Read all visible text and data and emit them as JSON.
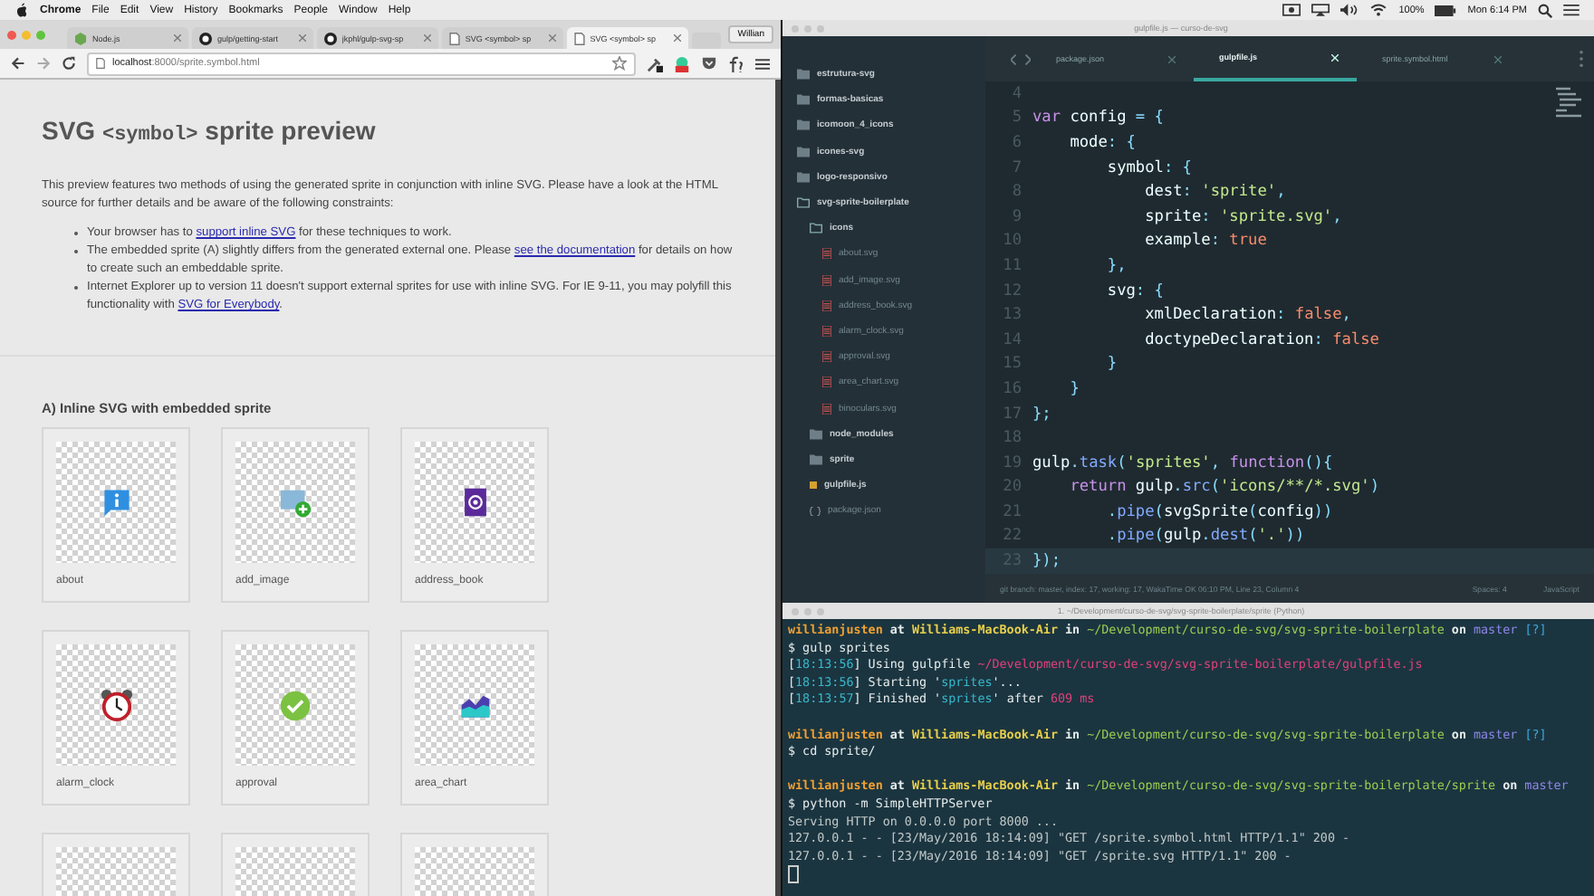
{
  "menu_bar": {
    "app": "Chrome",
    "items": [
      "File",
      "Edit",
      "View",
      "History",
      "Bookmarks",
      "People",
      "Window",
      "Help"
    ],
    "battery": "100%",
    "clock": "Mon 6:14 PM"
  },
  "browser": {
    "tabs": [
      {
        "title": "Node.js",
        "kind": "node",
        "selected": false
      },
      {
        "title": "gulp/getting-start",
        "kind": "repo",
        "selected": false
      },
      {
        "title": "jkphl/gulp-svg-sp",
        "kind": "repo",
        "selected": false
      },
      {
        "title": "SVG <symbol> sp",
        "kind": "page",
        "selected": false
      },
      {
        "title": "SVG <symbol> sp",
        "kind": "page",
        "selected": true
      }
    ],
    "profile": "Willian",
    "url_host": "localhost",
    "url_path": ":8000/sprite.symbol.html",
    "page": {
      "title_before": "SVG ",
      "title_code": "<symbol>",
      "title_after": " sprite preview",
      "intro": "This preview features two methods of using the generated sprite in conjunction with inline SVG. Please have a look at the HTML source for further details and be aware of the following constraints:",
      "bullets": [
        [
          {
            "text": "Your browser has to "
          },
          {
            "text": "support inline SVG",
            "link": true
          },
          {
            "text": " for these techniques to work."
          }
        ],
        [
          {
            "text": "The embedded sprite (A) slightly differs from the generated external one. Please "
          },
          {
            "text": "see the documentation",
            "link": true
          },
          {
            "text": " for details on how to create such an embeddable sprite."
          }
        ],
        [
          {
            "text": "Internet Explorer up to version 11 doesn't support external sprites for use with inline SVG. For IE 9-11, you may polyfill this functionality with "
          },
          {
            "text": "SVG for Everybody",
            "link": true
          },
          {
            "text": "."
          }
        ]
      ],
      "section_title": "A) Inline SVG with embedded sprite",
      "sprites": [
        {
          "kind": "info",
          "label": "about"
        },
        {
          "kind": "image-add",
          "label": "add_image"
        },
        {
          "kind": "address-book",
          "label": "address_book"
        },
        {
          "kind": "alarm",
          "label": "alarm_clock"
        },
        {
          "kind": "check",
          "label": "approval"
        },
        {
          "kind": "area-chart",
          "label": "area_chart"
        },
        {
          "kind": "blank"
        },
        {
          "kind": "blank"
        },
        {
          "kind": "blank"
        }
      ]
    }
  },
  "editor": {
    "title": "gulpfile.js — curso-de-svg",
    "sidebar": [
      {
        "name": "estrutura-svg",
        "kind": "folder",
        "expanded": false
      },
      {
        "name": "formas-basicas",
        "kind": "folder",
        "expanded": false
      },
      {
        "name": "icomoon_4_icons",
        "kind": "folder",
        "expanded": false
      },
      {
        "name": "icones-svg",
        "kind": "folder",
        "expanded": false
      },
      {
        "name": "logo-responsivo",
        "kind": "folder",
        "expanded": false
      },
      {
        "name": "svg-sprite-boilerplate",
        "kind": "folder",
        "expanded": true,
        "children": [
          {
            "name": "icons",
            "kind": "folder",
            "expanded": true,
            "children": [
              {
                "name": "about.svg",
                "kind": "svg"
              },
              {
                "name": "add_image.svg",
                "kind": "svg"
              },
              {
                "name": "address_book.svg",
                "kind": "svg"
              },
              {
                "name": "alarm_clock.svg",
                "kind": "svg"
              },
              {
                "name": "approval.svg",
                "kind": "svg"
              },
              {
                "name": "area_chart.svg",
                "kind": "svg"
              },
              {
                "name": "binoculars.svg",
                "kind": "svg"
              }
            ]
          },
          {
            "name": "node_modules",
            "kind": "folder",
            "expanded": false
          },
          {
            "name": "sprite",
            "kind": "folder",
            "expanded": false
          },
          {
            "name": "gulpfile.js",
            "kind": "js"
          },
          {
            "name": "package.json",
            "kind": "json"
          }
        ]
      }
    ],
    "tabs": [
      {
        "title": "package.json",
        "selected": false
      },
      {
        "title": "gulpfile.js",
        "selected": true
      },
      {
        "title": "sprite.symbol.html",
        "selected": false
      }
    ],
    "lines": [
      {
        "number": "4",
        "current": false
      },
      {
        "number": "5",
        "current": false,
        "tokens": [
          {
            "kind": "kw",
            "text": "var "
          },
          {
            "kind": "id",
            "text": "config "
          },
          {
            "kind": "op",
            "text": "= {"
          }
        ]
      },
      {
        "number": "6",
        "current": false,
        "tokens": [
          {
            "kind": "id",
            "text": "    mode"
          },
          {
            "kind": "op",
            "text": ": {"
          }
        ]
      },
      {
        "number": "7",
        "current": false,
        "tokens": [
          {
            "kind": "id",
            "text": "        symbol"
          },
          {
            "kind": "op",
            "text": ": {"
          }
        ]
      },
      {
        "number": "8",
        "current": false,
        "tokens": [
          {
            "kind": "id",
            "text": "            dest"
          },
          {
            "kind": "op",
            "text": ": "
          },
          {
            "kind": "str",
            "text": "'sprite'"
          },
          {
            "kind": "op",
            "text": ","
          }
        ]
      },
      {
        "number": "9",
        "current": false,
        "tokens": [
          {
            "kind": "id",
            "text": "            sprite"
          },
          {
            "kind": "op",
            "text": ": "
          },
          {
            "kind": "str",
            "text": "'sprite.svg'"
          },
          {
            "kind": "op",
            "text": ","
          }
        ]
      },
      {
        "number": "10",
        "current": false,
        "tokens": [
          {
            "kind": "id",
            "text": "            example"
          },
          {
            "kind": "op",
            "text": ": "
          },
          {
            "kind": "bool",
            "text": "true"
          }
        ]
      },
      {
        "number": "11",
        "current": false,
        "tokens": [
          {
            "kind": "op",
            "text": "        },"
          }
        ]
      },
      {
        "number": "12",
        "current": false,
        "tokens": [
          {
            "kind": "id",
            "text": "        svg"
          },
          {
            "kind": "op",
            "text": ": {"
          }
        ]
      },
      {
        "number": "13",
        "current": false,
        "tokens": [
          {
            "kind": "id",
            "text": "            xmlDeclaration"
          },
          {
            "kind": "op",
            "text": ": "
          },
          {
            "kind": "bool",
            "text": "false"
          },
          {
            "kind": "op",
            "text": ","
          }
        ]
      },
      {
        "number": "14",
        "current": false,
        "tokens": [
          {
            "kind": "id",
            "text": "            doctypeDeclaration"
          },
          {
            "kind": "op",
            "text": ": "
          },
          {
            "kind": "bool",
            "text": "false"
          }
        ]
      },
      {
        "number": "15",
        "current": false,
        "tokens": [
          {
            "kind": "op",
            "text": "        }"
          }
        ]
      },
      {
        "number": "16",
        "current": false,
        "tokens": [
          {
            "kind": "op",
            "text": "    }"
          }
        ]
      },
      {
        "number": "17",
        "current": false,
        "tokens": [
          {
            "kind": "op",
            "text": "};"
          }
        ]
      },
      {
        "number": "18",
        "current": false
      },
      {
        "number": "19",
        "current": false,
        "tokens": [
          {
            "kind": "id",
            "text": "gulp"
          },
          {
            "kind": "op",
            "text": "."
          },
          {
            "kind": "fn",
            "text": "task"
          },
          {
            "kind": "op",
            "text": "("
          },
          {
            "kind": "str",
            "text": "'sprites'"
          },
          {
            "kind": "op",
            "text": ", "
          },
          {
            "kind": "kw",
            "text": "function"
          },
          {
            "kind": "op",
            "text": "(){"
          }
        ]
      },
      {
        "number": "20",
        "current": false,
        "tokens": [
          {
            "kind": "kw",
            "text": "    return "
          },
          {
            "kind": "id",
            "text": "gulp"
          },
          {
            "kind": "op",
            "text": "."
          },
          {
            "kind": "fn",
            "text": "src"
          },
          {
            "kind": "op",
            "text": "("
          },
          {
            "kind": "str",
            "text": "'icons/**/*.svg'"
          },
          {
            "kind": "op",
            "text": ")"
          }
        ]
      },
      {
        "number": "21",
        "current": false,
        "tokens": [
          {
            "kind": "op",
            "text": "        ."
          },
          {
            "kind": "fn",
            "text": "pipe"
          },
          {
            "kind": "op",
            "text": "("
          },
          {
            "kind": "id",
            "text": "svgSprite"
          },
          {
            "kind": "op",
            "text": "("
          },
          {
            "kind": "id",
            "text": "config"
          },
          {
            "kind": "op",
            "text": "))"
          }
        ]
      },
      {
        "number": "22",
        "current": false,
        "tokens": [
          {
            "kind": "op",
            "text": "        ."
          },
          {
            "kind": "fn",
            "text": "pipe"
          },
          {
            "kind": "op",
            "text": "("
          },
          {
            "kind": "id",
            "text": "gulp"
          },
          {
            "kind": "op",
            "text": "."
          },
          {
            "kind": "fn",
            "text": "dest"
          },
          {
            "kind": "op",
            "text": "("
          },
          {
            "kind": "str",
            "text": "'.'"
          },
          {
            "kind": "op",
            "text": "))"
          }
        ]
      },
      {
        "number": "23",
        "current": true,
        "tokens": [
          {
            "kind": "op",
            "text": "});"
          }
        ]
      }
    ],
    "status_left": "git branch: master, index: 17, working: 17, WakaTime OK 06:10 PM, Line 23, Column 4",
    "spaces": "Spaces: 4",
    "language": "JavaScript"
  },
  "terminal": {
    "title": "1. ~/Development/curso-de-svg/svg-sprite-boilerplate/sprite (Python)",
    "blocks": [
      [
        [
          {
            "kind": "user",
            "text": "willianjusten"
          },
          {
            "kind": "plain",
            "text": " at "
          },
          {
            "kind": "host",
            "text": "Williams-MacBook-Air"
          },
          {
            "kind": "plain",
            "text": " in "
          },
          {
            "kind": "path",
            "text": "~/Development/curso-de-svg/svg-sprite-boilerplate"
          },
          {
            "kind": "plain",
            "text": " on "
          },
          {
            "kind": "branch",
            "text": "master"
          },
          {
            "kind": "qmark",
            "text": " [?]"
          }
        ],
        [
          {
            "kind": "plain",
            "text": "$ gulp sprites"
          }
        ],
        [
          {
            "kind": "plain",
            "text": "["
          },
          {
            "kind": "time",
            "text": "18:13:56"
          },
          {
            "kind": "plain",
            "text": "] Using gulpfile "
          },
          {
            "kind": "file",
            "text": "~/Development/curso-de-svg/svg-sprite-boilerplate/gulpfile.js"
          }
        ],
        [
          {
            "kind": "plain",
            "text": "["
          },
          {
            "kind": "time",
            "text": "18:13:56"
          },
          {
            "kind": "plain",
            "text": "] Starting '"
          },
          {
            "kind": "time",
            "text": "sprites"
          },
          {
            "kind": "plain",
            "text": "'..."
          }
        ],
        [
          {
            "kind": "plain",
            "text": "["
          },
          {
            "kind": "time",
            "text": "18:13:57"
          },
          {
            "kind": "plain",
            "text": "] Finished '"
          },
          {
            "kind": "time",
            "text": "sprites"
          },
          {
            "kind": "plain",
            "text": "' after "
          },
          {
            "kind": "file",
            "text": "609 ms"
          }
        ]
      ],
      [
        [
          {
            "kind": "user",
            "text": "willianjusten"
          },
          {
            "kind": "plain",
            "text": " at "
          },
          {
            "kind": "host",
            "text": "Williams-MacBook-Air"
          },
          {
            "kind": "plain",
            "text": " in "
          },
          {
            "kind": "path",
            "text": "~/Development/curso-de-svg/svg-sprite-boilerplate"
          },
          {
            "kind": "plain",
            "text": " on "
          },
          {
            "kind": "branch",
            "text": "master"
          },
          {
            "kind": "qmark",
            "text": " [?]"
          }
        ],
        [
          {
            "kind": "plain",
            "text": "$ cd sprite/"
          }
        ]
      ],
      [
        [
          {
            "kind": "user",
            "text": "willianjusten"
          },
          {
            "kind": "plain",
            "text": " at "
          },
          {
            "kind": "host",
            "text": "Williams-MacBook-Air"
          },
          {
            "kind": "plain",
            "text": " in "
          },
          {
            "kind": "path",
            "text": "~/Development/curso-de-svg/svg-sprite-boilerplate/sprite"
          },
          {
            "kind": "plain",
            "text": " on "
          },
          {
            "kind": "branch",
            "text": "master"
          }
        ],
        [
          {
            "kind": "plain",
            "text": "$ python -m SimpleHTTPServer"
          }
        ],
        [
          {
            "kind": "dim",
            "text": "Serving HTTP on 0.0.0.0 port 8000 ..."
          }
        ],
        [
          {
            "kind": "dim",
            "text": "127.0.0.1 - - [23/May/2016 18:14:09] \"GET /sprite.symbol.html HTTP/1.1\" 200 -"
          }
        ],
        [
          {
            "kind": "dim",
            "text": "127.0.0.1 - - [23/May/2016 18:14:09] \"GET /sprite.svg HTTP/1.1\" 200 -"
          }
        ]
      ]
    ]
  }
}
